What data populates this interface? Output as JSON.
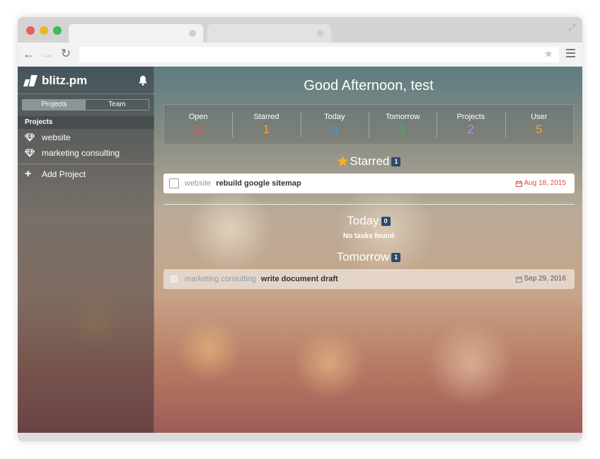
{
  "app": {
    "brand": "blitz.pm"
  },
  "sidebar": {
    "toggle": {
      "left": "Projects",
      "right": "Team"
    },
    "section_label": "Projects",
    "projects": [
      {
        "label": "website"
      },
      {
        "label": "marketing consulting"
      }
    ],
    "add_label": "Add Project"
  },
  "main": {
    "greeting": "Good Afternoon, test",
    "stats": [
      {
        "label": "Open",
        "value": "11",
        "color": "#e0524f"
      },
      {
        "label": "Starred",
        "value": "1",
        "color": "#f0a33a"
      },
      {
        "label": "Today",
        "value": "0",
        "color": "#3a9ae0"
      },
      {
        "label": "Tomorrow",
        "value": "1",
        "color": "#3bb85a"
      },
      {
        "label": "Projects",
        "value": "2",
        "color": "#b48ed8"
      },
      {
        "label": "User",
        "value": "5",
        "color": "#f0a33a"
      }
    ],
    "starred": {
      "title": "Starred",
      "count": "1",
      "tasks": [
        {
          "project": "website",
          "title": "rebuild google sitemap",
          "date": "Aug 18, 2015"
        }
      ]
    },
    "today": {
      "title": "Today",
      "count": "0",
      "empty_text": "No tasks found"
    },
    "tomorrow": {
      "title": "Tomorrow",
      "count": "1",
      "tasks": [
        {
          "project": "marketing consulting",
          "title": "write document draft",
          "date": "Sep 29, 2016"
        }
      ]
    }
  },
  "colors": {
    "badge": "#2d4b6b",
    "overdue": "#e04a4a",
    "star": "#f5b025"
  }
}
